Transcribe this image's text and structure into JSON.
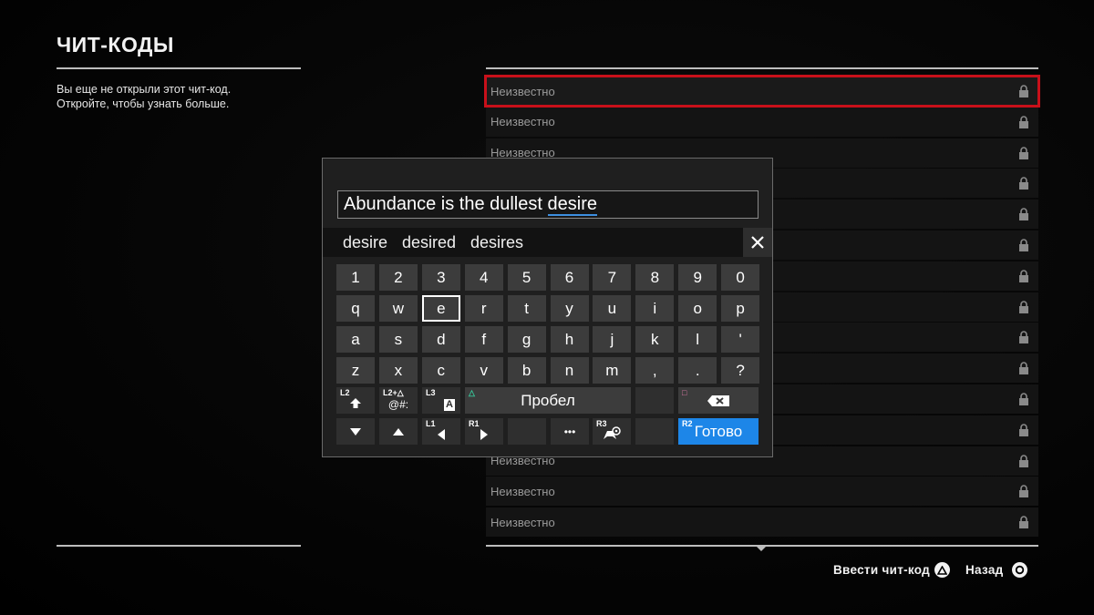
{
  "page": {
    "title": "ЧИТ-КОДЫ",
    "description_line1": "Вы еще не открыли этот чит-код.",
    "description_line2": "Откройте, чтобы узнать больше."
  },
  "cheat_list": {
    "item_label": "Неизвестно",
    "items": [
      "Неизвестно",
      "Неизвестно",
      "Неизвестно",
      "Неизвестно",
      "Неизвестно",
      "Неизвестно",
      "Неизвестно",
      "Неизвестно",
      "Неизвестно",
      "Неизвестно",
      "Неизвестно",
      "Неизвестно",
      "Неизвестно",
      "Неизвестно",
      "Неизвестно"
    ],
    "selected_index": 0
  },
  "keyboard": {
    "input_prefix": "Abundance is the dullest ",
    "input_underlined": "desire",
    "suggestions": [
      "desire",
      "desired",
      "desires"
    ],
    "rows": [
      [
        "1",
        "2",
        "3",
        "4",
        "5",
        "6",
        "7",
        "8",
        "9",
        "0"
      ],
      [
        "q",
        "w",
        "e",
        "r",
        "t",
        "y",
        "u",
        "i",
        "o",
        "p"
      ],
      [
        "a",
        "s",
        "d",
        "f",
        "g",
        "h",
        "j",
        "k",
        "l",
        "'"
      ],
      [
        "z",
        "x",
        "c",
        "v",
        "b",
        "n",
        "m",
        ",",
        ".",
        "?"
      ]
    ],
    "selected_key": "e",
    "shift_hint": "L2",
    "symbols_hint": "L2+△",
    "symbols_label": "@#:",
    "lang_hint": "L3",
    "lang_label": "A",
    "space_hint": "△",
    "space_label": "Пробел",
    "backspace_hint": "□",
    "left_hint": "L1",
    "right_hint": "R1",
    "more_label": "•••",
    "cursor_hint": "R3",
    "done_hint": "R2",
    "done_label": "Готово"
  },
  "prompts": {
    "enter_code": "Ввести чит-код",
    "back": "Назад"
  },
  "colors": {
    "selection_red": "#c8101a",
    "done_blue": "#1d86e8",
    "triangle_green": "#38c79a",
    "square_pink": "#e07aa9"
  }
}
